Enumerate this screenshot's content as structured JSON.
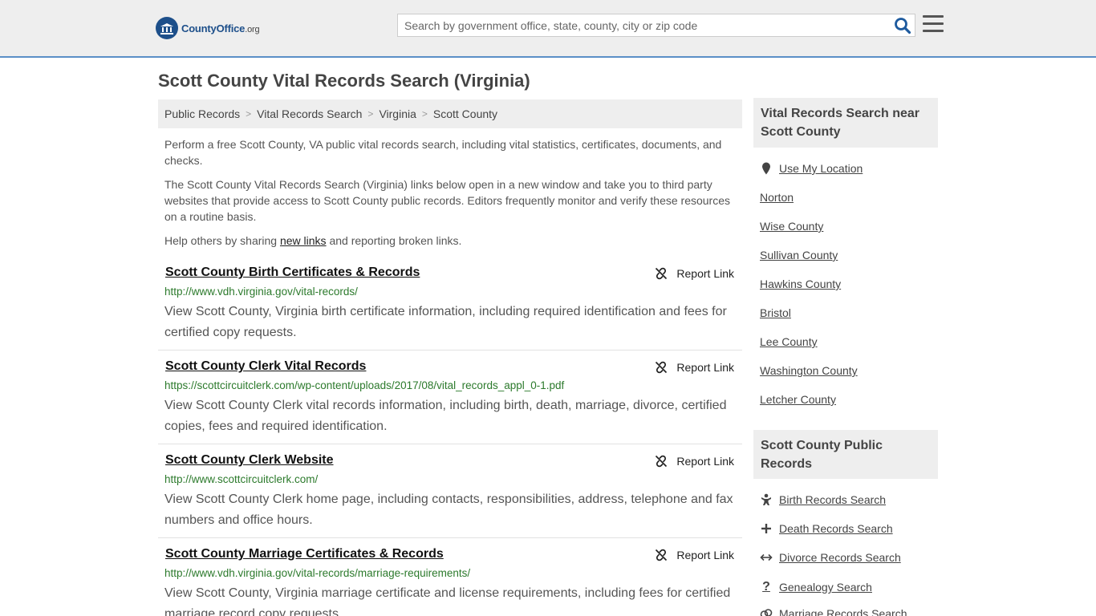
{
  "header": {
    "logo_name": "CountyOffice",
    "logo_tld": ".org",
    "search_placeholder": "Search by government office, state, county, city or zip code"
  },
  "page_title": "Scott County Vital Records Search (Virginia)",
  "breadcrumb": [
    "Public Records",
    "Vital Records Search",
    "Virginia",
    "Scott County"
  ],
  "intro": {
    "p1": "Perform a free Scott County, VA public vital records search, including vital statistics, certificates, documents, and checks.",
    "p2": "The Scott County Vital Records Search (Virginia) links below open in a new window and take you to third party websites that provide access to Scott County public records. Editors frequently monitor and verify these resources on a routine basis.",
    "p3_before": "Help others by sharing ",
    "p3_link": "new links",
    "p3_after": " and reporting broken links."
  },
  "report_label": "Report Link",
  "results": [
    {
      "title": "Scott County Birth Certificates & Records",
      "url": "http://www.vdh.virginia.gov/vital-records/",
      "desc": "View Scott County, Virginia birth certificate information, including required identification and fees for certified copy requests."
    },
    {
      "title": "Scott County Clerk Vital Records",
      "url": "https://scottcircuitclerk.com/wp-content/uploads/2017/08/vital_records_appl_0-1.pdf",
      "desc": "View Scott County Clerk vital records information, including birth, death, marriage, divorce, certified copies, fees and required identification."
    },
    {
      "title": "Scott County Clerk Website",
      "url": "http://www.scottcircuitclerk.com/",
      "desc": "View Scott County Clerk home page, including contacts, responsibilities, address, telephone and fax numbers and office hours."
    },
    {
      "title": "Scott County Marriage Certificates & Records",
      "url": "http://www.vdh.virginia.gov/vital-records/marriage-requirements/",
      "desc": "View Scott County, Virginia marriage certificate and license requirements, including fees for certified marriage record copy requests."
    }
  ],
  "sidebar": {
    "nearby_title": "Vital Records Search near Scott County",
    "use_location": "Use My Location",
    "nearby": [
      "Norton",
      "Wise County",
      "Sullivan County",
      "Hawkins County",
      "Bristol",
      "Lee County",
      "Washington County",
      "Letcher County"
    ],
    "public_title": "Scott County Public Records",
    "public_links": [
      {
        "label": "Birth Records Search",
        "icon": "baby-icon"
      },
      {
        "label": "Death Records Search",
        "icon": "cross-icon"
      },
      {
        "label": "Divorce Records Search",
        "icon": "split-arrows-icon"
      },
      {
        "label": "Genealogy Search",
        "icon": "question-icon"
      },
      {
        "label": "Marriage Records Search",
        "icon": "rings-icon"
      }
    ]
  }
}
